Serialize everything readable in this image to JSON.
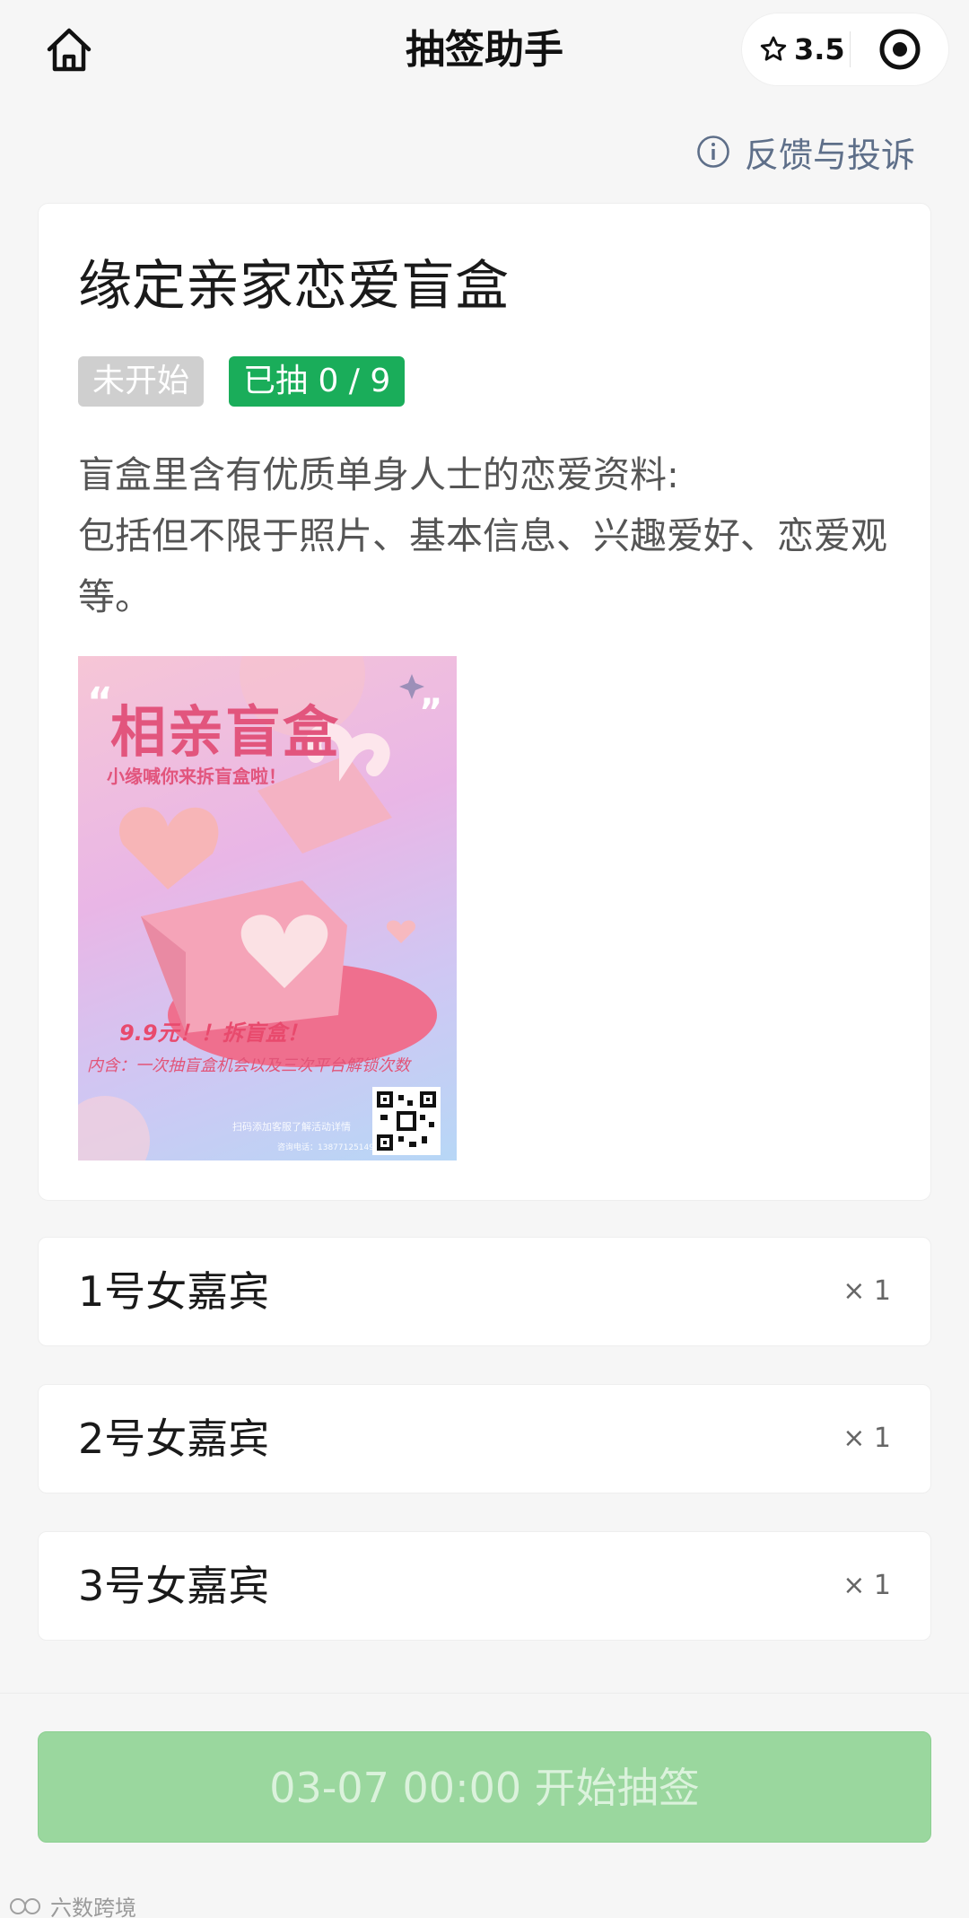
{
  "nav": {
    "title": "抽签助手",
    "rating": "3.5"
  },
  "feedback": {
    "label": "反馈与投诉"
  },
  "card": {
    "title": "缘定亲家恋爱盲盒",
    "status_tag": "未开始",
    "draw_tag": "已抽 0 / 9",
    "description": "盲盒里含有优质单身人士的恋爱资料:\n包括但不限于照片、基本信息、兴趣爱好、恋爱观等。",
    "poster": {
      "title": "相亲盲盒",
      "subtitle": "小缘喊你来拆盲盒啦！",
      "price": "9.9元！！拆盲盒！",
      "contains": "内含：一次抽盲盒机会以及三次平台解锁次数",
      "scan": "扫码添加客服了解活动详情",
      "phone": "咨询电话：13877125149"
    }
  },
  "items": [
    {
      "label": "1号女嘉宾",
      "count": "× 1"
    },
    {
      "label": "2号女嘉宾",
      "count": "× 1"
    },
    {
      "label": "3号女嘉宾",
      "count": "× 1"
    }
  ],
  "bottom": {
    "button_label": "03-07 00:00 开始抽签"
  },
  "watermark": "六数跨境",
  "colors": {
    "accent_green": "#1aad5a",
    "button_green": "#9ad79e",
    "link": "#5e6f89"
  }
}
